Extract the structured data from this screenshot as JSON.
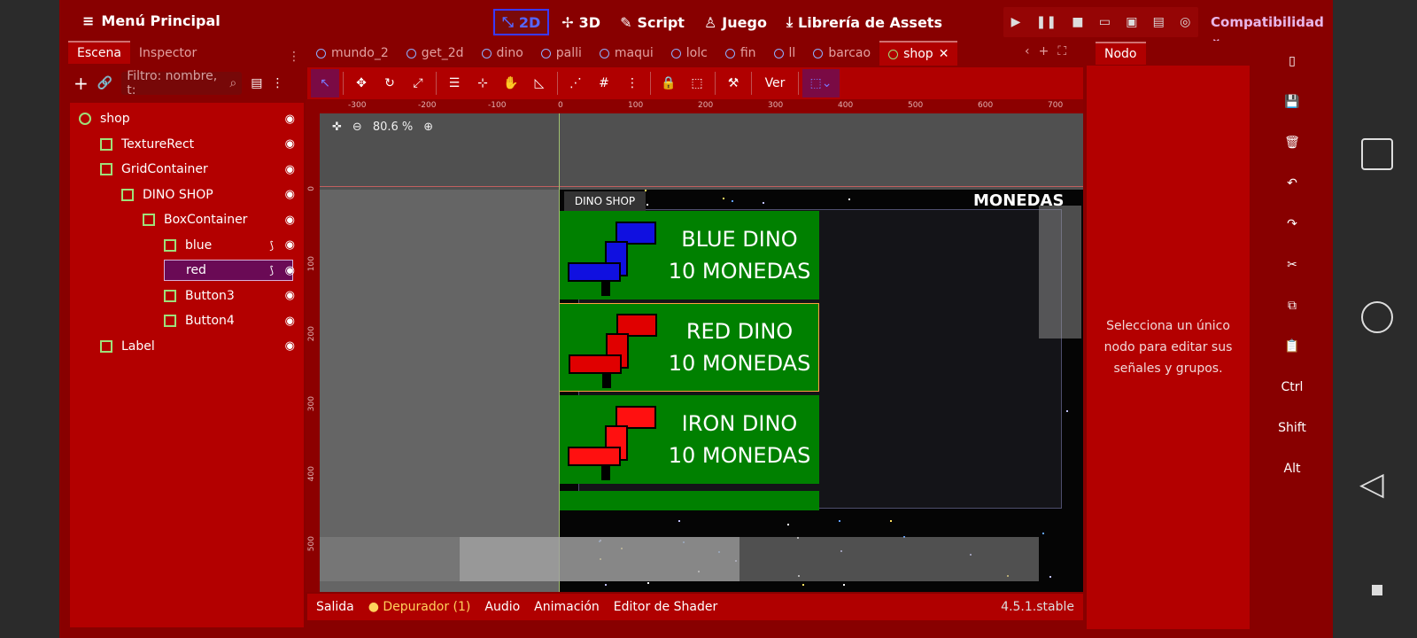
{
  "menu": {
    "label": "Menú Principal"
  },
  "modes": [
    {
      "label": "2D",
      "icon": "2d-icon",
      "active": true
    },
    {
      "label": "3D",
      "icon": "3d-icon"
    },
    {
      "label": "Script",
      "icon": "script-icon"
    },
    {
      "label": "Juego",
      "icon": "game-icon"
    },
    {
      "label": "Librería de Assets",
      "icon": "asset-library-icon"
    }
  ],
  "renderer": "Compatibilidad",
  "scene_panel": {
    "tabs": [
      "Escena",
      "Inspector"
    ],
    "filter_placeholder": "Filtro: nombre, t:",
    "tree": [
      {
        "label": "shop",
        "icon": "node-icon",
        "depth": 0
      },
      {
        "label": "TextureRect",
        "icon": "texturerect-icon",
        "depth": 1
      },
      {
        "label": "GridContainer",
        "icon": "gridcontainer-icon",
        "depth": 1
      },
      {
        "label": "DINO SHOP",
        "icon": "panel-icon",
        "depth": 2
      },
      {
        "label": "BoxContainer",
        "icon": "boxcontainer-icon",
        "depth": 3
      },
      {
        "label": "blue",
        "icon": "button-icon",
        "depth": 4,
        "signal": true
      },
      {
        "label": "red",
        "icon": "button-icon",
        "depth": 4,
        "signal": true,
        "selected": true
      },
      {
        "label": "Button3",
        "icon": "button-icon",
        "depth": 4
      },
      {
        "label": "Button4",
        "icon": "button-icon",
        "depth": 4
      },
      {
        "label": "Label",
        "icon": "label-icon",
        "depth": 1
      }
    ]
  },
  "tabs": [
    {
      "label": "mundo_2"
    },
    {
      "label": "get_2d"
    },
    {
      "label": "dino"
    },
    {
      "label": "palli"
    },
    {
      "label": "maqui"
    },
    {
      "label": "lolc"
    },
    {
      "label": "fin"
    },
    {
      "label": "ll"
    },
    {
      "label": "barcao"
    },
    {
      "label": "shop",
      "active": true
    }
  ],
  "toolbar": {
    "ver_label": "Ver"
  },
  "ruler_h": [
    "-300",
    "-200",
    "-100",
    "0",
    "100",
    "200",
    "300",
    "400",
    "500",
    "600",
    "700"
  ],
  "ruler_v": [
    "0",
    "100",
    "200",
    "300",
    "400",
    "500"
  ],
  "viewport": {
    "zoom": "80.6 %",
    "shop_title": "DINO SHOP",
    "monedas": "MONEDAS",
    "items": [
      {
        "name": "BLUE DINO",
        "price": "10 MONEDAS",
        "color": "#1010e0"
      },
      {
        "name": "RED DINO",
        "price": "10 MONEDAS",
        "color": "#e00000",
        "selected": true
      },
      {
        "name": "IRON DINO",
        "price": "10 MONEDAS",
        "color": "#ff1010"
      }
    ]
  },
  "bottom": {
    "items": [
      "Salida",
      "Depurador (1)",
      "Audio",
      "Animación",
      "Editor de Shader"
    ],
    "version": "4.5.1.stable"
  },
  "node_panel": {
    "tab": "Nodo",
    "message": "Selecciona un único nodo para editar sus señales y grupos."
  },
  "side_tools": [
    "Ctrl",
    "Shift",
    "Alt"
  ],
  "colors": {
    "accent": "#880000",
    "panel": "#b30000",
    "selected": "#6a0a55"
  }
}
